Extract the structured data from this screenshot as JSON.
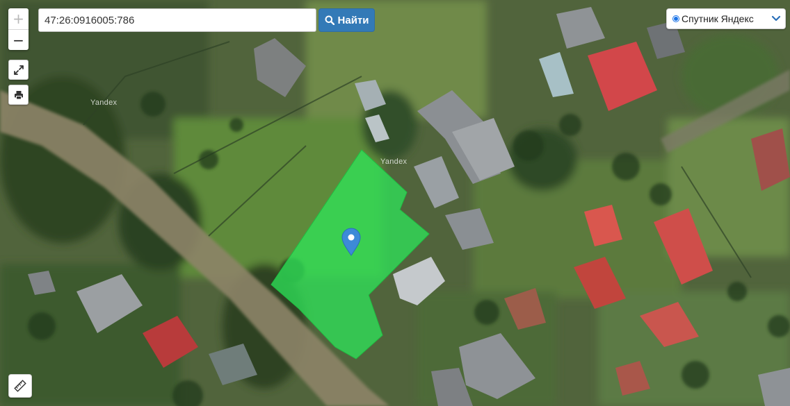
{
  "search": {
    "value": "47:26:0916005:786",
    "button_label": "Найти"
  },
  "zoom": {
    "in_label": "+",
    "out_label": "−"
  },
  "layer": {
    "selected": "Спутник Яндекс"
  },
  "map": {
    "provider_watermark": "Yandex",
    "parcel_color": "#2ee65a",
    "marker_color": "#3d8ad8"
  },
  "colors": {
    "accent": "#337ab7"
  }
}
